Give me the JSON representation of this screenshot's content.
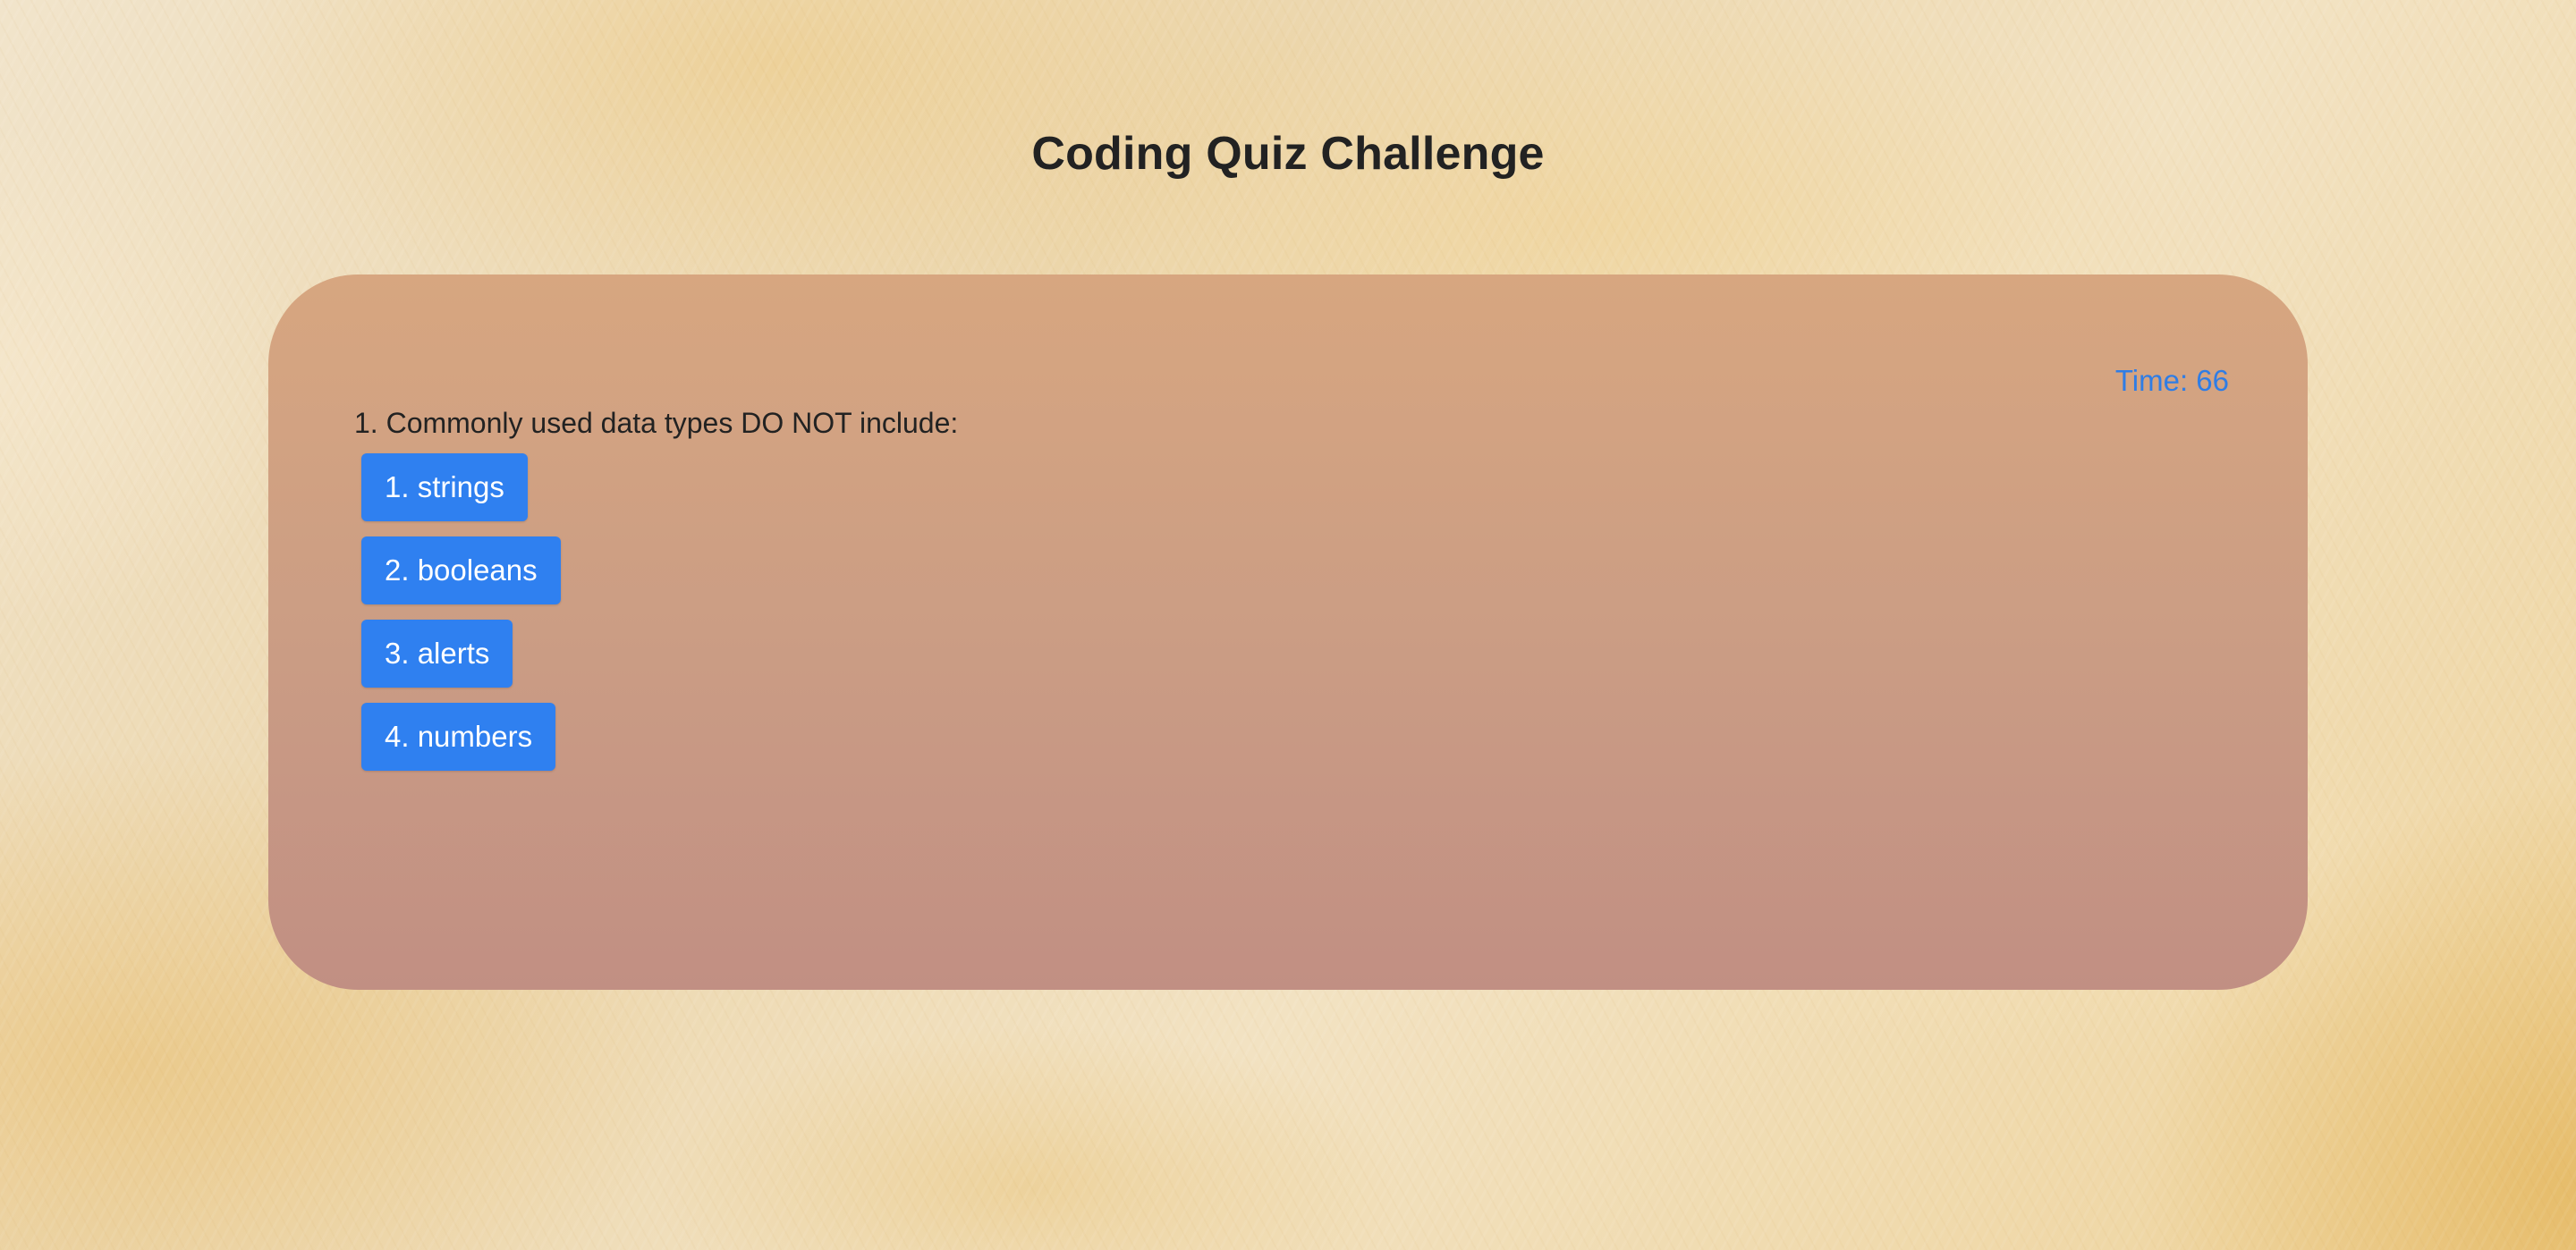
{
  "app": {
    "title": "Coding Quiz Challenge"
  },
  "quiz": {
    "timer_text": "Time: 66",
    "question": "1. Commonly used data types DO NOT include:",
    "choices": [
      {
        "label": "1. strings"
      },
      {
        "label": "2. booleans"
      },
      {
        "label": "3. alerts"
      },
      {
        "label": "4. numbers"
      }
    ]
  },
  "colors": {
    "button": "#2f80f0",
    "timer": "#2f7de5",
    "card_top": "#d7a680",
    "card_bottom": "#c18f83"
  }
}
